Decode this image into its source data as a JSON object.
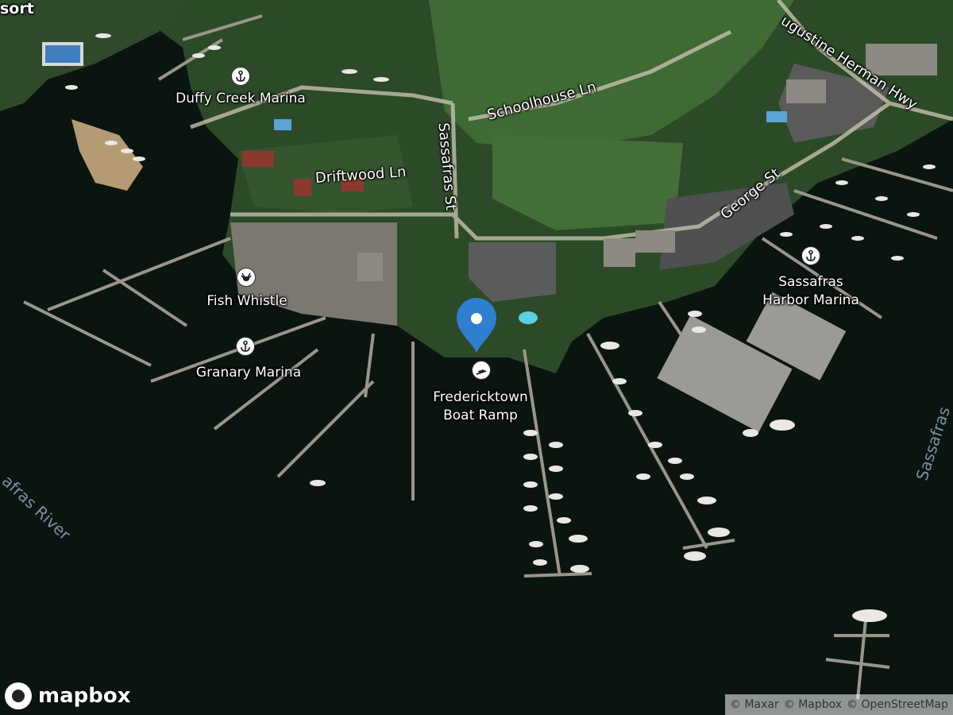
{
  "map": {
    "places": [
      {
        "id": "duffy",
        "label": "Duffy Creek Marina",
        "icon": "harbor-icon"
      },
      {
        "id": "fishwhistle",
        "label": "Fish Whistle",
        "icon": "seafood-restaurant-icon"
      },
      {
        "id": "granary",
        "label": "Granary Marina",
        "icon": "harbor-icon"
      },
      {
        "id": "sassafras_harbor",
        "label_line1": "Sassafras",
        "label_line2": "Harbor Marina",
        "icon": "harbor-icon"
      },
      {
        "id": "ramp",
        "label_line1": "Fredericktown",
        "label_line2": "Boat Ramp",
        "icon": "boat-ramp-icon"
      }
    ],
    "streets": {
      "schoolhouse": "Schoolhouse Ln",
      "driftwood": "Driftwood Ln",
      "sassafras_st": "Sassafras St",
      "george": "George St",
      "augustine": "ugustine Herman Hwy",
      "resort_fragment": "sort"
    },
    "water": {
      "river_left": "afras River",
      "river_right": "Sassafras"
    },
    "marker": {
      "icon": "location-pin-icon",
      "color": "#2f7fd1"
    }
  },
  "brand": {
    "logo_text": "mapbox"
  },
  "attribution": {
    "maxar": "© Maxar",
    "mapbox": "© Mapbox",
    "osm": "© OpenStreetMap"
  }
}
